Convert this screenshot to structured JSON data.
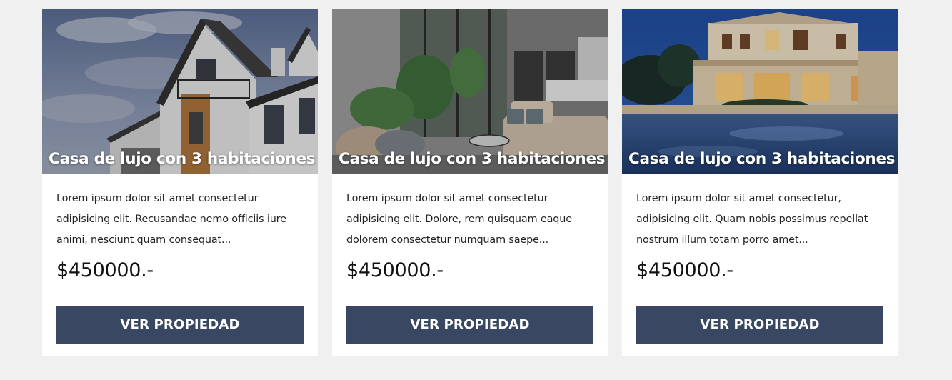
{
  "colors": {
    "page_background": "#f0f0f0",
    "card_background": "#ffffff",
    "button_background": "#3a4762",
    "button_text": "#ffffff"
  },
  "cards": [
    {
      "title": "Casa de lujo con 3 habitaciones",
      "description": "Lorem ipsum dolor sit amet consectetur adipisicing elit. Recusandae nemo officiis iure animi, nesciunt quam consequat...",
      "price": "$450000.-",
      "button_label": "VER PROPIEDAD",
      "image_icon": "house-exterior-photo"
    },
    {
      "title": "Casa de lujo con 3 habitaciones",
      "description": "Lorem ipsum dolor sit amet consectetur adipisicing elit. Dolore, rem quisquam eaque dolorem consectetur numquam saepe...",
      "price": "$450000.-",
      "button_label": "VER PROPIEDAD",
      "image_icon": "living-room-interior-photo"
    },
    {
      "title": "Casa de lujo con 3 habitaciones",
      "description": "Lorem ipsum dolor sit amet consectetur, adipisicing elit. Quam nobis possimus repellat nostrum illum totam porro amet...",
      "price": "$450000.-",
      "button_label": "VER PROPIEDAD",
      "image_icon": "villa-pool-night-photo"
    }
  ]
}
